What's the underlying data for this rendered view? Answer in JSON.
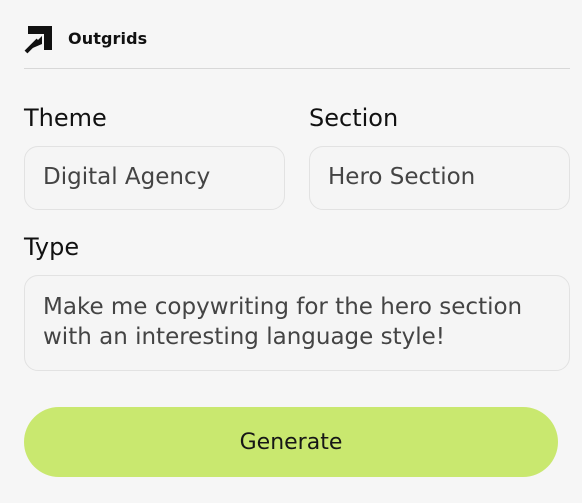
{
  "header": {
    "brand_name": "Outgrids",
    "logo_icon": "outgrids-logo-icon"
  },
  "form": {
    "theme": {
      "label": "Theme",
      "value": "Digital Agency"
    },
    "section": {
      "label": "Section",
      "value": "Hero Section"
    },
    "type": {
      "label": "Type",
      "value": "Make me copywriting for the hero section\nwith an interesting language style!"
    }
  },
  "actions": {
    "generate_label": "Generate"
  },
  "colors": {
    "accent": "#c9e86f",
    "background": "#f6f6f6",
    "field_border": "#e2e2e2",
    "text_primary": "#111111",
    "text_secondary": "#444444"
  }
}
